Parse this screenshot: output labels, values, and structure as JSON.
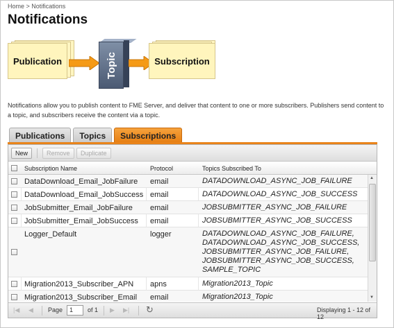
{
  "breadcrumb": "Home > Notifications",
  "page": {
    "title": "Notifications"
  },
  "diagram": {
    "publication": "Publication",
    "topic": "Topic",
    "subscription": "Subscription"
  },
  "intro": "Notifications allow you to publish content to FME Server, and deliver that content to one or more subscribers. Publishers send content to a topic, and subscribers receive the content via a topic.",
  "tabs": [
    {
      "label": "Publications",
      "active": false
    },
    {
      "label": "Topics",
      "active": false
    },
    {
      "label": "Subscriptions",
      "active": true
    }
  ],
  "toolbar": {
    "new": "New",
    "remove": "Remove",
    "duplicate": "Duplicate"
  },
  "table": {
    "columns": [
      "Subscription Name",
      "Protocol",
      "Topics Subscribed To"
    ],
    "rows": [
      {
        "name": "DataDownload_Email_JobFailure",
        "protocol": "email",
        "topics": "DATADOWNLOAD_ASYNC_JOB_FAILURE"
      },
      {
        "name": "DataDownload_Email_JobSuccess",
        "protocol": "email",
        "topics": "DATADOWNLOAD_ASYNC_JOB_SUCCESS"
      },
      {
        "name": "JobSubmitter_Email_JobFailure",
        "protocol": "email",
        "topics": "JOBSUBMITTER_ASYNC_JOB_FAILURE"
      },
      {
        "name": "JobSubmitter_Email_JobSuccess",
        "protocol": "email",
        "topics": "JOBSUBMITTER_ASYNC_JOB_SUCCESS"
      },
      {
        "name": "Logger_Default",
        "protocol": "logger",
        "topics": "DATADOWNLOAD_ASYNC_JOB_FAILURE,\nDATADOWNLOAD_ASYNC_JOB_SUCCESS,\nJOBSUBMITTER_ASYNC_JOB_FAILURE,\nJOBSUBMITTER_ASYNC_JOB_SUCCESS,\nSAMPLE_TOPIC"
      },
      {
        "name": "Migration2013_Subscriber_APN",
        "protocol": "apns",
        "topics": "Migration2013_Topic"
      },
      {
        "name": "Migration2013_Subscriber_Email",
        "protocol": "email",
        "topics": "Migration2013_Topic"
      }
    ]
  },
  "pager": {
    "page_label": "Page",
    "page_value": "1",
    "of_label": "of 1",
    "displaying": "Displaying 1 - 12 of 12"
  },
  "colors": {
    "accent": "#e9841a",
    "card": "#fff5bd",
    "topic": "#5a6a85"
  }
}
